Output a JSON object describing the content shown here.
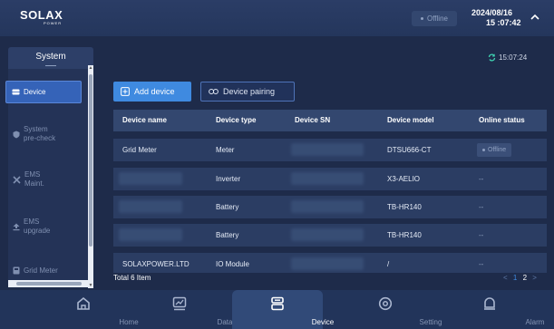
{
  "header": {
    "logo": "SOLAX",
    "logo_sub": "POWER",
    "connection_status": "Offline",
    "date": "2024/08/16",
    "time": "15 :07:42"
  },
  "sidebar": {
    "title": "System",
    "items": [
      {
        "label": "Device",
        "icon": "device-icon",
        "active": true
      },
      {
        "label": "System pre-check",
        "line1": "System",
        "line2": "pre-check",
        "icon": "shield-check-icon"
      },
      {
        "label": "EMS Maint.",
        "line1": "EMS",
        "line2": "Maint.",
        "icon": "tools-icon"
      },
      {
        "label": "EMS upgrade",
        "line1": "EMS",
        "line2": "upgrade",
        "icon": "upgrade-icon"
      },
      {
        "label": "Grid Meter",
        "icon": "meter-icon"
      }
    ]
  },
  "toolbar": {
    "refresh_time": "15:07:24",
    "add_device_label": "Add device",
    "device_pairing_label": "Device pairing"
  },
  "table": {
    "columns": [
      "Device name",
      "Device type",
      "Device SN",
      "Device model",
      "Online status"
    ],
    "rows": [
      {
        "name": "Grid Meter",
        "type": "Meter",
        "sn": "",
        "model": "DTSU666-CT",
        "status": "Offline"
      },
      {
        "name": "",
        "type": "Inverter",
        "sn": "",
        "model": "X3-AELIO",
        "status": "--"
      },
      {
        "name": "",
        "type": "Battery",
        "sn": "",
        "model": "TB-HR140",
        "status": "--"
      },
      {
        "name": "",
        "type": "Battery",
        "sn": "",
        "model": "TB-HR140",
        "status": "--"
      },
      {
        "name": "SOLAXPOWER.LTD",
        "type": "IO Module",
        "sn": "",
        "model": "/",
        "status": "--"
      }
    ],
    "total": "Total 6 Item",
    "pager": {
      "prev": "<",
      "page1": "1",
      "page2": "2",
      "next": ">"
    }
  },
  "bottom_nav": [
    {
      "label": "Home",
      "icon": "home-icon"
    },
    {
      "label": "Data",
      "icon": "chart-icon"
    },
    {
      "label": "Device",
      "icon": "device-stack-icon",
      "active": true
    },
    {
      "label": "Setting",
      "icon": "setting-icon"
    },
    {
      "label": "Alarm",
      "icon": "alarm-icon"
    }
  ],
  "colors": {
    "accent": "#3f8ae0",
    "background": "#1e2b4a",
    "header": "#2b3d66"
  }
}
